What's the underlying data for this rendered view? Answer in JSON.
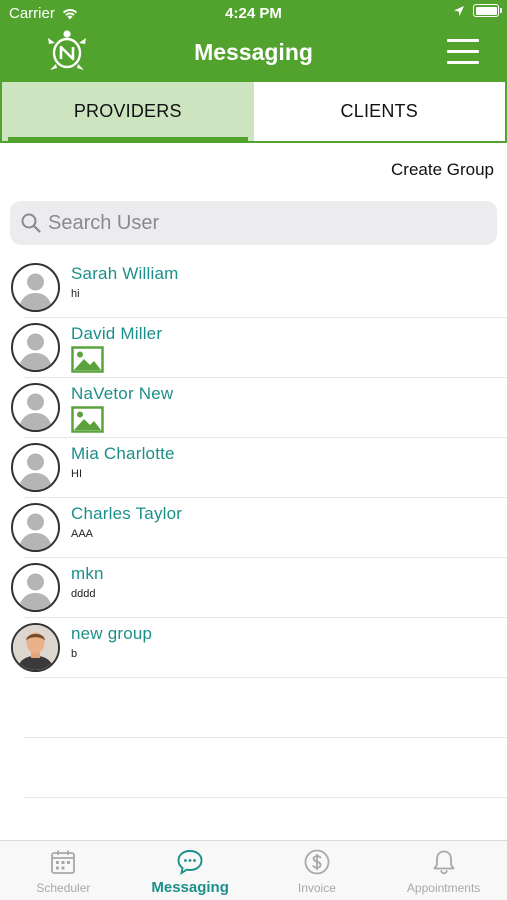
{
  "status_bar": {
    "carrier": "Carrier",
    "time": "4:24 PM"
  },
  "nav": {
    "title": "Messaging"
  },
  "segments": {
    "providers": "PROVIDERS",
    "clients": "CLIENTS"
  },
  "create_group": "Create Group",
  "search": {
    "placeholder": "Search User"
  },
  "contacts": [
    {
      "name": "Sarah William",
      "message": "hi"
    },
    {
      "name": "David Miller",
      "message": ""
    },
    {
      "name": "NaVetor New",
      "message": ""
    },
    {
      "name": "Mia Charlotte",
      "message": "HI"
    },
    {
      "name": "Charles Taylor",
      "message": "AAA"
    },
    {
      "name": "mkn",
      "message": "dddd"
    },
    {
      "name": "new group",
      "message": "b"
    }
  ],
  "tabbar": {
    "scheduler": "Scheduler",
    "messaging": "Messaging",
    "invoice": "Invoice",
    "appointments": "Appointments"
  },
  "colors": {
    "brand_green": "#52a32d",
    "teal": "#1b8f8a",
    "tab_active_bg": "#cde4c1"
  }
}
